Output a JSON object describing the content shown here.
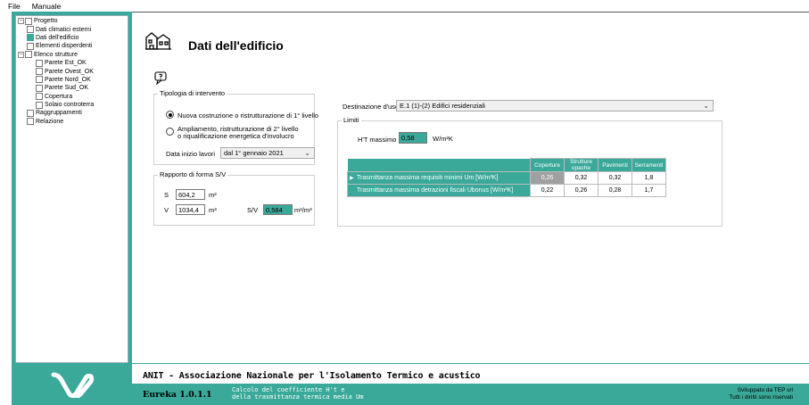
{
  "menu": {
    "file": "File",
    "manuale": "Manuale"
  },
  "tree": [
    {
      "label": "Progetto",
      "level": 0,
      "expander": "⊟",
      "checked": false
    },
    {
      "label": "Dati climatici esterni",
      "level": 1,
      "checked": false
    },
    {
      "label": "Dati dell'edificio",
      "level": 1,
      "checked": true
    },
    {
      "label": "Elementi disperdenti",
      "level": 1,
      "checked": false
    },
    {
      "label": "Elenco strutture",
      "level": 0,
      "expander": "⊟",
      "checked": false,
      "sub": true
    },
    {
      "label": "Parete Est_OK",
      "level": 2,
      "checked": false
    },
    {
      "label": "Parete Ovest_OK",
      "level": 2,
      "checked": false
    },
    {
      "label": "Parete Nord_OK",
      "level": 2,
      "checked": false
    },
    {
      "label": "Parete Sud_OK",
      "level": 2,
      "checked": false
    },
    {
      "label": "Copertura",
      "level": 2,
      "checked": false
    },
    {
      "label": "Solaio controterra",
      "level": 2,
      "checked": false
    },
    {
      "label": "Raggruppamenti",
      "level": 1,
      "checked": false
    },
    {
      "label": "Relazione",
      "level": 1,
      "checked": false
    }
  ],
  "page": {
    "title": "Dati dell'edificio"
  },
  "tipologia": {
    "group_title": "Tipologia di intervento",
    "option1": "Nuova costruzione o ristrutturazione di 1° livello",
    "option2_line1": "Ampliamento, ristrutturazione di 2° livello",
    "option2_line2": "o riqualificazione energetica d'involucro",
    "data_label": "Data inizio lavori",
    "data_value": "dal 1° gennaio 2021"
  },
  "rapporto": {
    "group_title": "Rapporto di forma S/V",
    "s_label": "S",
    "s_value": "604,2",
    "s_unit": "m²",
    "v_label": "V",
    "v_value": "1034,4",
    "v_unit": "m³",
    "sv_label": "S/V",
    "sv_value": "0,584",
    "sv_unit": "m²/m³"
  },
  "destinazione": {
    "label": "Destinazione d'uso",
    "value": "E.1 (1)-(2) Edifici residenziali"
  },
  "limiti": {
    "group_title": "Limiti",
    "ht_label": "H'T massimo",
    "ht_value": "0,58",
    "ht_unit": "W/m²K",
    "headers": [
      "Coperture",
      "Strutture opache",
      "Pavimenti",
      "Serramenti"
    ],
    "rows": [
      {
        "label": "Trasmittanza massima requisiti minimi Um [W/m²K]",
        "values": [
          "0,26",
          "0,32",
          "0,32",
          "1,8"
        ]
      },
      {
        "label": "Trasmittanza massima detrazioni fiscali Ubonus [W/m²K]",
        "values": [
          "0,22",
          "0,26",
          "0,28",
          "1,7"
        ]
      }
    ]
  },
  "footer": {
    "title": "ANIT - Associazione Nazionale per l'Isolamento Termico e acustico",
    "version": "Eureka 1.0.1.1",
    "desc_line1": "Calcolo del coefficiente H't e",
    "desc_line2": "della trasmittanza termica media Um",
    "credits_line1": "Sviluppato da TEP srl",
    "credits_line2": "Tutti i diritti sono riservati"
  },
  "colors": {
    "accent": "#3aa99a"
  }
}
